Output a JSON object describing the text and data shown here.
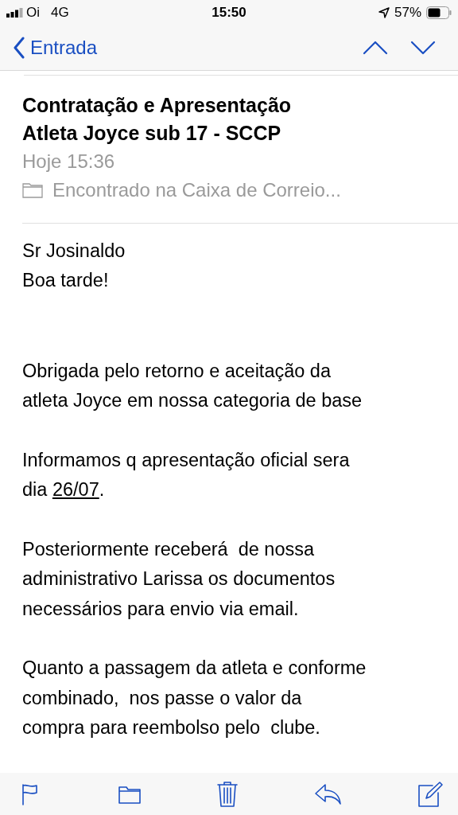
{
  "status_bar": {
    "carrier": "Oi",
    "network": "4G",
    "time": "15:50",
    "battery": "57%"
  },
  "nav": {
    "back": "Entrada"
  },
  "message": {
    "subject": "Contratação e Apresentação\nAtleta Joyce sub 17 - SCCP",
    "date": "Hoje 15:36",
    "mailbox": "Encontrado na Caixa de Correio..."
  },
  "body": [
    [
      {
        "text": "Sr Josinaldo\nBoa tarde!"
      }
    ],
    [
      {
        "text": "Obrigada pelo retorno e aceitação da\natleta Joyce em nossa categoria de base"
      }
    ],
    [
      {
        "text": "Informamos q apresentação oficial sera\ndia "
      },
      {
        "text": "26/07",
        "kind": "link"
      },
      {
        "text": "."
      }
    ],
    [
      {
        "text": "Posteriormente receberá  de nossa\nadministrativo Larissa os documentos\nnecessários para envio via email."
      }
    ],
    [
      {
        "text": "Quanto a passagem da atleta e conforme\ncombinado,  nos passe o valor da\ncompra para reembolso pelo  clube."
      }
    ]
  ]
}
